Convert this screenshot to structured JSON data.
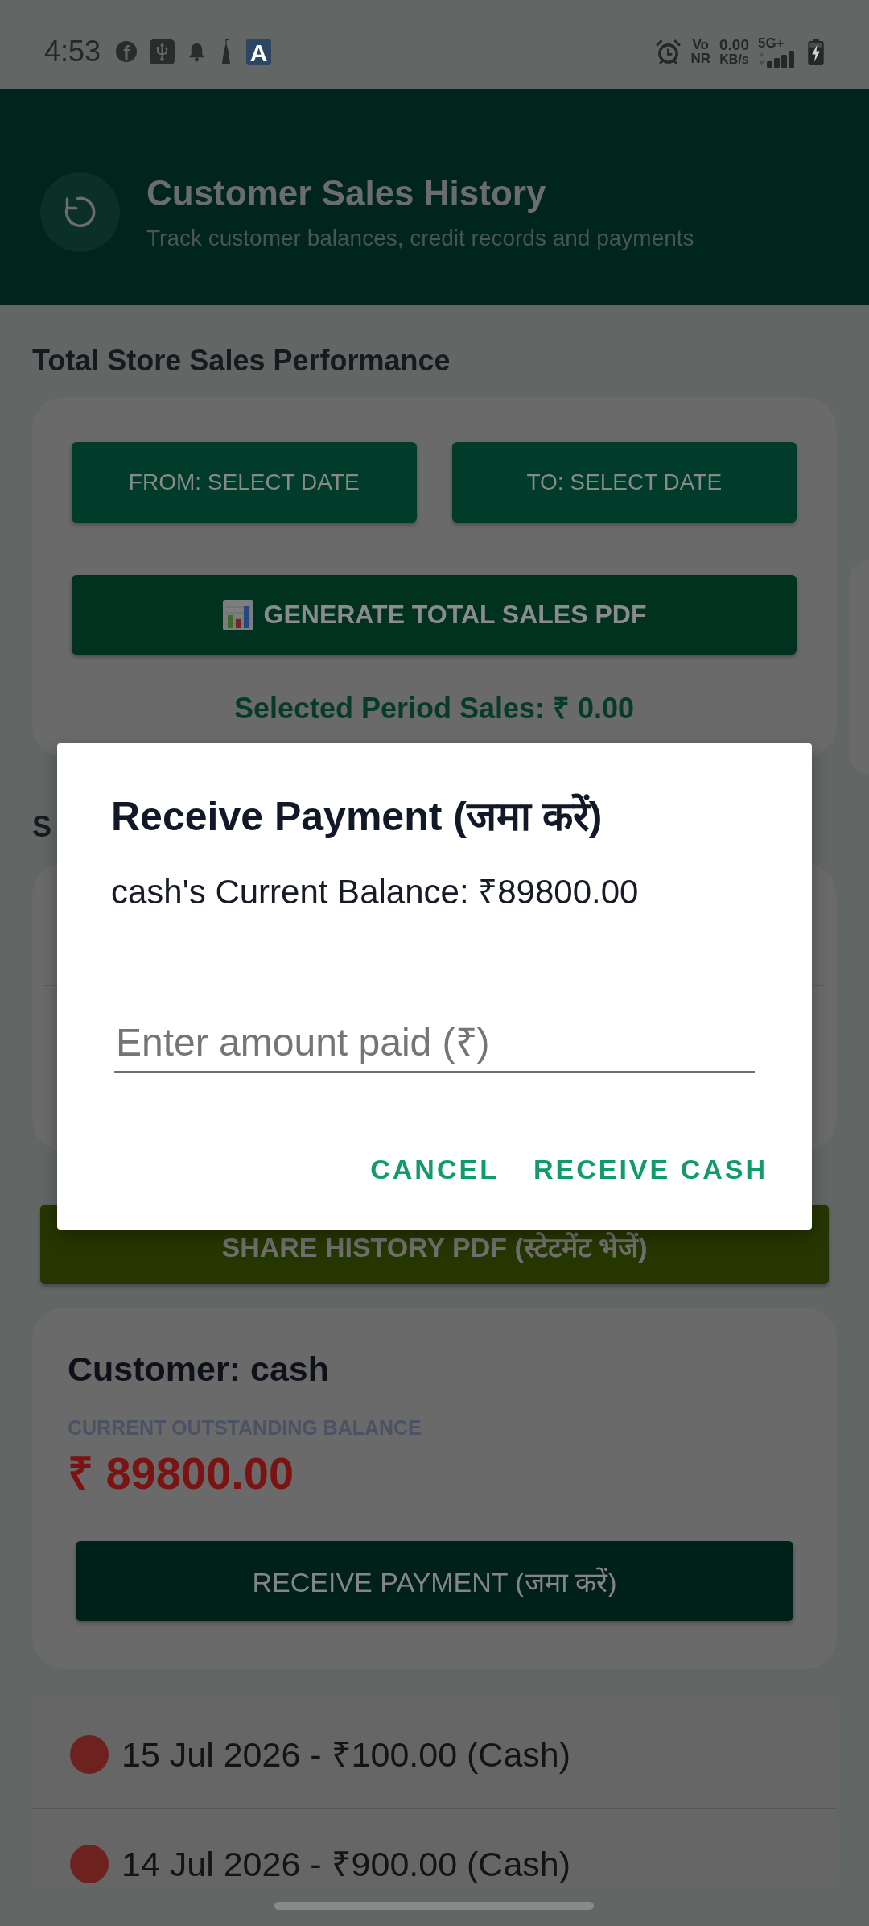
{
  "status_bar": {
    "time": "4:53",
    "social_icon_letter": "f",
    "app_icon_letter": "A",
    "network_top": "Vo",
    "network_bottom": "NR",
    "speed": "0.00",
    "speed_unit": "KB/s",
    "network_generation": "5G+"
  },
  "header": {
    "title": "Customer Sales History",
    "subtitle": "Track customer balances, credit records and payments"
  },
  "sales_performance": {
    "heading": "Total Store Sales Performance",
    "from_button": "FROM: SELECT DATE",
    "to_button": "TO: SELECT DATE",
    "generate_button": "GENERATE TOTAL SALES PDF",
    "period_sales": "Selected Period Sales: ₹ 0.00"
  },
  "second_section": {
    "heading": "S"
  },
  "share_button": "SHARE HISTORY PDF (स्टेटमेंट भेजें)",
  "customer_card": {
    "title": "Customer: cash",
    "balance_label": "CURRENT OUTSTANDING BALANCE",
    "balance": "₹ 89800.00",
    "receive_button": "RECEIVE PAYMENT (जमा करें)"
  },
  "history": [
    {
      "text": "15 Jul 2026 - ₹100.00 (Cash)",
      "color": "#6d2220"
    },
    {
      "text": "14 Jul 2026 - ₹900.00 (Cash)",
      "color": "#6d2220"
    }
  ],
  "dialog": {
    "title": "Receive Payment (जमा करें)",
    "message": "cash's Current Balance: ₹89800.00",
    "amount_field": {
      "placeholder": "Enter amount paid (₹)"
    },
    "buttons": [
      "CANCEL",
      "RECEIVE CASH"
    ]
  }
}
